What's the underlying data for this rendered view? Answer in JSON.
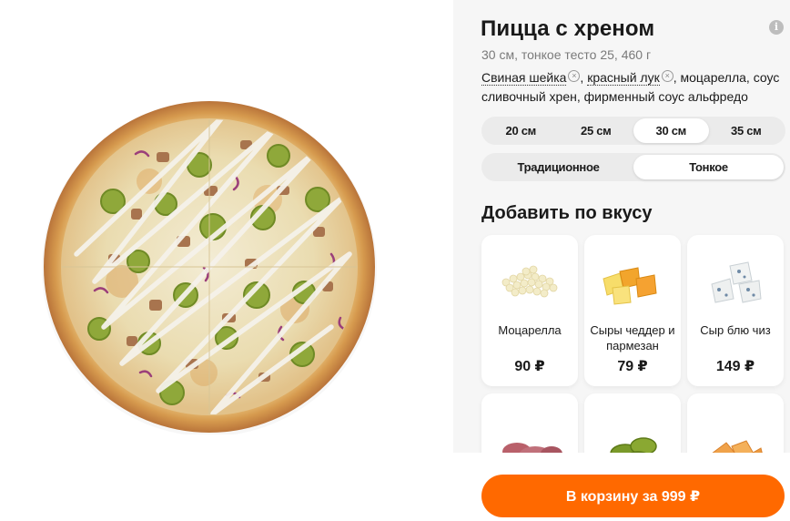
{
  "product": {
    "title": "Пицца с хреном",
    "subtitle": "30 см, тонкое тесто 25, 460 г",
    "ingredients": {
      "removable_1": "Свиная шейка",
      "sep_1": ", ",
      "removable_2": "красный лук",
      "rest": ", моцарелла, соус сливочный хрен, фирменный соус альфредо"
    },
    "info_icon": "info-icon"
  },
  "sizes": {
    "options": [
      "20 см",
      "25 см",
      "30 см",
      "35 см"
    ],
    "selected": "30 см"
  },
  "dough": {
    "options": [
      "Традиционное",
      "Тонкое"
    ],
    "selected": "Тонкое"
  },
  "toppings_section": {
    "title": "Добавить по вкусу",
    "items": [
      {
        "name": "Моцарелла",
        "price": "90 ₽",
        "icon": "mozzarella-icon"
      },
      {
        "name": "Сыры чеддер и пармезан",
        "price": "79 ₽",
        "icon": "cheddar-parmesan-icon"
      },
      {
        "name": "Сыр блю чиз",
        "price": "149 ₽",
        "icon": "blue-cheese-icon"
      },
      {
        "icon": "ham-icon"
      },
      {
        "icon": "jalapeno-icon"
      },
      {
        "icon": "chicken-icon"
      }
    ]
  },
  "cart": {
    "button_label": "В корзину за 999 ₽"
  },
  "colors": {
    "accent": "#ff6900",
    "panel_bg": "#f6f6f6"
  }
}
